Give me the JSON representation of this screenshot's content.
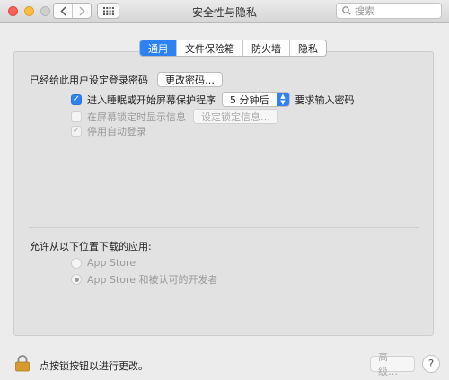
{
  "window": {
    "title": "安全性与隐私"
  },
  "search": {
    "placeholder": "搜索"
  },
  "tabs": [
    {
      "label": "通用",
      "active": true
    },
    {
      "label": "文件保险箱",
      "active": false
    },
    {
      "label": "防火墙",
      "active": false
    },
    {
      "label": "隐私",
      "active": false
    }
  ],
  "general": {
    "password_label": "已经给此用户设定登录密码",
    "change_password_button": "更改密码…",
    "require_password": {
      "checked": true,
      "label": "进入睡眠或开始屏幕保护程序",
      "delay": "5 分钟后",
      "suffix": "要求输入密码"
    },
    "lock_message": {
      "checked": false,
      "enabled": false,
      "label": "在屏幕锁定时显示信息",
      "button": "设定锁定信息…"
    },
    "disable_autologin": {
      "checked": true,
      "enabled": false,
      "label": "停用自动登录"
    }
  },
  "downloads": {
    "heading": "允许从以下位置下载的应用:",
    "options": [
      {
        "label": "App Store",
        "selected": false
      },
      {
        "label": "App Store 和被认可的开发者",
        "selected": true
      }
    ]
  },
  "footer": {
    "lock_text": "点按锁按钮以进行更改。",
    "advanced_button": "高级…",
    "help_button": "?"
  },
  "colors": {
    "accent": "#2e82f7",
    "lock": "#d79a2b"
  }
}
